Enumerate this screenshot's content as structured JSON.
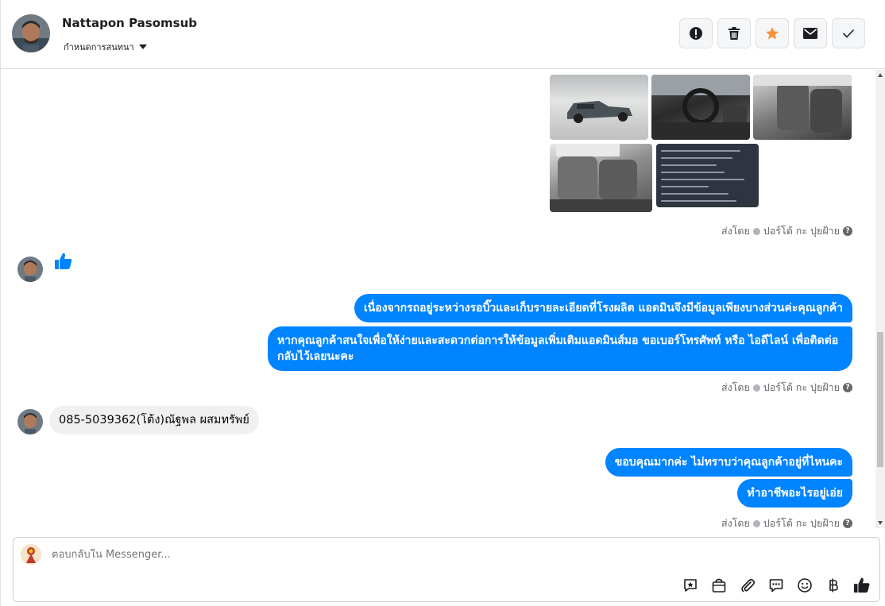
{
  "header": {
    "name": "Nattapon Pasomsub",
    "subtitle": "กำหนดการสนทนา"
  },
  "header_actions": [
    {
      "name": "spam-icon"
    },
    {
      "name": "trash-icon"
    },
    {
      "name": "star-icon",
      "color": "#f7923b"
    },
    {
      "name": "mail-icon"
    },
    {
      "name": "check-icon"
    }
  ],
  "thread": {
    "sent_by_label": "ส่งโดย",
    "sent_by_name": "ปอร์โต้ กะ ปุยฝ้าย",
    "messages_out_1": [
      "เนื่องจากรถอยู่ระหว่างรอบิ๊วและเก็บรายละเอียดที่โรงผลิต แอดมินจึงมีข้อมูลเพียงบางส่วนค่ะคุณลูกค้า",
      "หากคุณลูกค้าสนใจเพื่อให้ง่ายและสะดวกต่อการให้ข้อมูลเพิ่มเติมแอดมินส์มอ ขอเบอร์โทรศัพท์ หรือ ไอดีไลน์ เพื่อติดต่อกลับไว้เลยนะคะ"
    ],
    "message_in": "085-5039362(โต้ง)ณัฐพล ผสมทรัพย์",
    "messages_out_2": [
      "ขอบคุณมากค่ะ ไม่ทราบว่าคุณลูกค้าอยู่ที่ไหนคะ",
      "ทำอาชีพอะไรอยู่เอ่ย"
    ],
    "accent_color": "#0084ff"
  },
  "composer": {
    "placeholder": "ตอบกลับใน Messenger...",
    "tools": [
      "saved-reply-icon",
      "shop-icon",
      "attachment-icon",
      "chat-bubble-icon",
      "emoji-icon",
      "baht-icon",
      "like-icon"
    ]
  }
}
